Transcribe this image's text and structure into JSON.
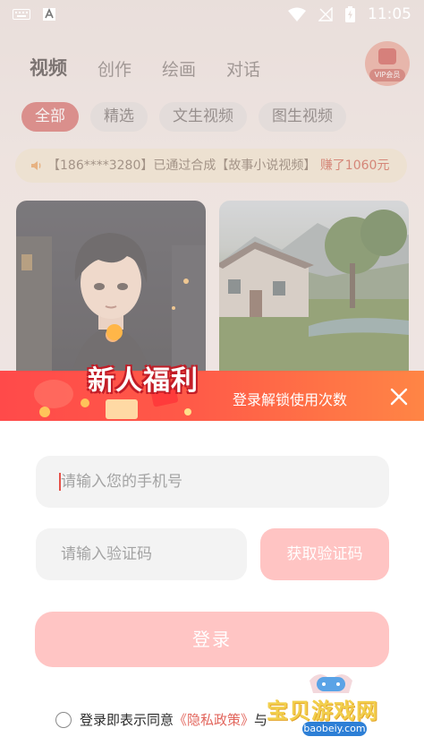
{
  "status_bar": {
    "time": "11:05",
    "icons": [
      "keyboard-icon",
      "a-icon",
      "wifi-icon",
      "no-signal-icon",
      "battery-charging-icon"
    ]
  },
  "top_nav": {
    "tabs": [
      {
        "label": "视频",
        "active": true
      },
      {
        "label": "创作",
        "active": false
      },
      {
        "label": "绘画",
        "active": false
      },
      {
        "label": "对话",
        "active": false
      }
    ],
    "vip_label": "VIP会员"
  },
  "categories": [
    {
      "label": "全部",
      "active": true
    },
    {
      "label": "精选",
      "active": false
    },
    {
      "label": "文生视频",
      "active": false
    },
    {
      "label": "图生视频",
      "active": false
    }
  ],
  "notice": {
    "text": "【186****3280】已通过合成【故事小说视频】",
    "earned": "赚了1060元"
  },
  "promo_banner": {
    "title": "新人福利",
    "subtitle": "登录解锁使用次数"
  },
  "login": {
    "phone_placeholder": "请输入您的手机号",
    "code_placeholder": "请输入验证码",
    "get_code_label": "获取验证码",
    "login_label": "登录",
    "agree_prefix": "登录即表示同意",
    "privacy_link": "《隐私政策》",
    "and": "与"
  },
  "watermark": {
    "text": "宝贝游戏网",
    "url": "baobeiy.com"
  },
  "colors": {
    "accent": "#cd5450",
    "banner_start": "#ff4a4a",
    "banner_end": "#ff8545",
    "button_disabled": "#ffc5c4",
    "link": "#e2655c"
  }
}
